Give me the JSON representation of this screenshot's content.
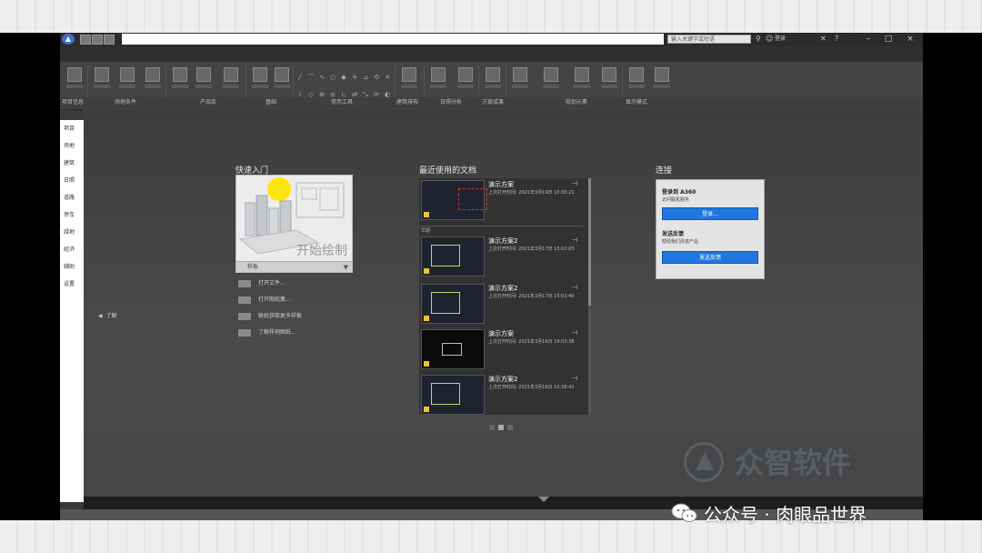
{
  "app": {
    "search_placeholder": "输入关键字或短语",
    "user_label": "登录",
    "help_label": "?"
  },
  "ribbon": {
    "panels": [
      "项目信息",
      "场地条件",
      "产品库",
      "基础",
      "常用工具",
      "建筑排布",
      "日照分析",
      "方案成果",
      "规划元素",
      "显示模式"
    ]
  },
  "left_nav": {
    "items": [
      "项目",
      "场地",
      "建筑",
      "日照",
      "道路",
      "停车",
      "绿地",
      "经济",
      "辅助",
      "设置"
    ]
  },
  "quick_start": {
    "title": "快速入门",
    "start_drawing": "开始绘制",
    "template_label": "样板",
    "links": [
      "打开文件...",
      "打开图纸集...",
      "联机获取更多样板",
      "了解样例图纸..."
    ],
    "collapse_label": "了解"
  },
  "recent": {
    "title": "最近使用的文档",
    "separator_label": "早期",
    "items": [
      {
        "name": "演示方案",
        "time": "上次打开时间: 2021年3月19日 10:30:21",
        "thumb": "plan-red"
      },
      {
        "name": "演示方案2",
        "time": "上次打开时间: 2021年3月17日 15:02:03",
        "thumb": "plan"
      },
      {
        "name": "演示方案2",
        "time": "上次打开时间: 2021年3月17日 15:01:40",
        "thumb": "plan"
      },
      {
        "name": "演示方案",
        "time": "上次打开时间: 2021年3月16日 19:03:38",
        "thumb": "dark"
      },
      {
        "name": "演示方案2",
        "time": "上次打开时间: 2021年3月16日 10:38:42",
        "thumb": "plan"
      }
    ]
  },
  "connect": {
    "title": "连接",
    "login_heading": "登录到 A360",
    "login_sub": "访问联机服务",
    "login_button": "登录...",
    "feedback_heading": "发送反馈",
    "feedback_sub": "帮助我们改进产品",
    "feedback_button": "发送反馈"
  },
  "watermark": {
    "brand": "众智软件",
    "wechat": "公众号 · 肉眼品世界"
  },
  "colors": {
    "accent_blue": "#1f78e0",
    "cursor_highlight": "#ffe600",
    "app_bg": "#3a3a3a"
  }
}
